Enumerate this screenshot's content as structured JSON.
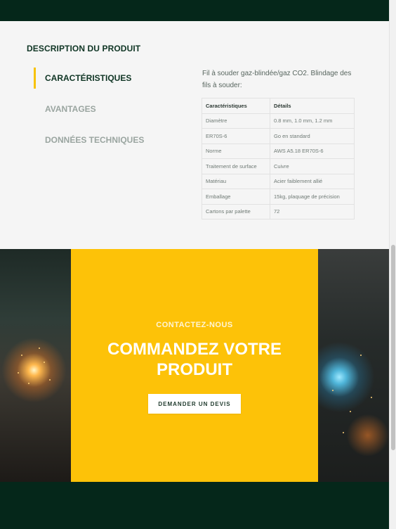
{
  "colors": {
    "dark_green": "#05271a",
    "accent_yellow": "#fdc208",
    "background": "#f5f5f5"
  },
  "product": {
    "section_title": "DESCRIPTION DU PRODUIT",
    "tabs": [
      {
        "label": "CARACTÉRISTIQUES",
        "active": true
      },
      {
        "label": "AVANTAGES",
        "active": false
      },
      {
        "label": "DONNÉES TECHNIQUES",
        "active": false
      }
    ],
    "description": "Fil à souder gaz-blindée/gaz CO2. Blindage des fils à souder:",
    "table": {
      "headers": [
        "Caractéristiques",
        "Détails"
      ],
      "rows": [
        [
          "Diamètre",
          "0.8 mm, 1.0 mm, 1.2 mm"
        ],
        [
          "ER70S-6",
          "Go en standard"
        ],
        [
          "Norme",
          "AWS A5.18 ER70S-6"
        ],
        [
          "Traitement de surface",
          "Cuivre"
        ],
        [
          "Matériau",
          "Acier faiblement allié"
        ],
        [
          "Emballage",
          "15kg, plaquage de précision"
        ],
        [
          "Cartons par palette",
          "72"
        ]
      ]
    }
  },
  "cta": {
    "kicker": "CONTACTEZ-NOUS",
    "headline_line1": "COMMANDEZ VOTRE",
    "headline_line2": "PRODUIT",
    "button_label": "DEMANDER UN DEVIS"
  }
}
